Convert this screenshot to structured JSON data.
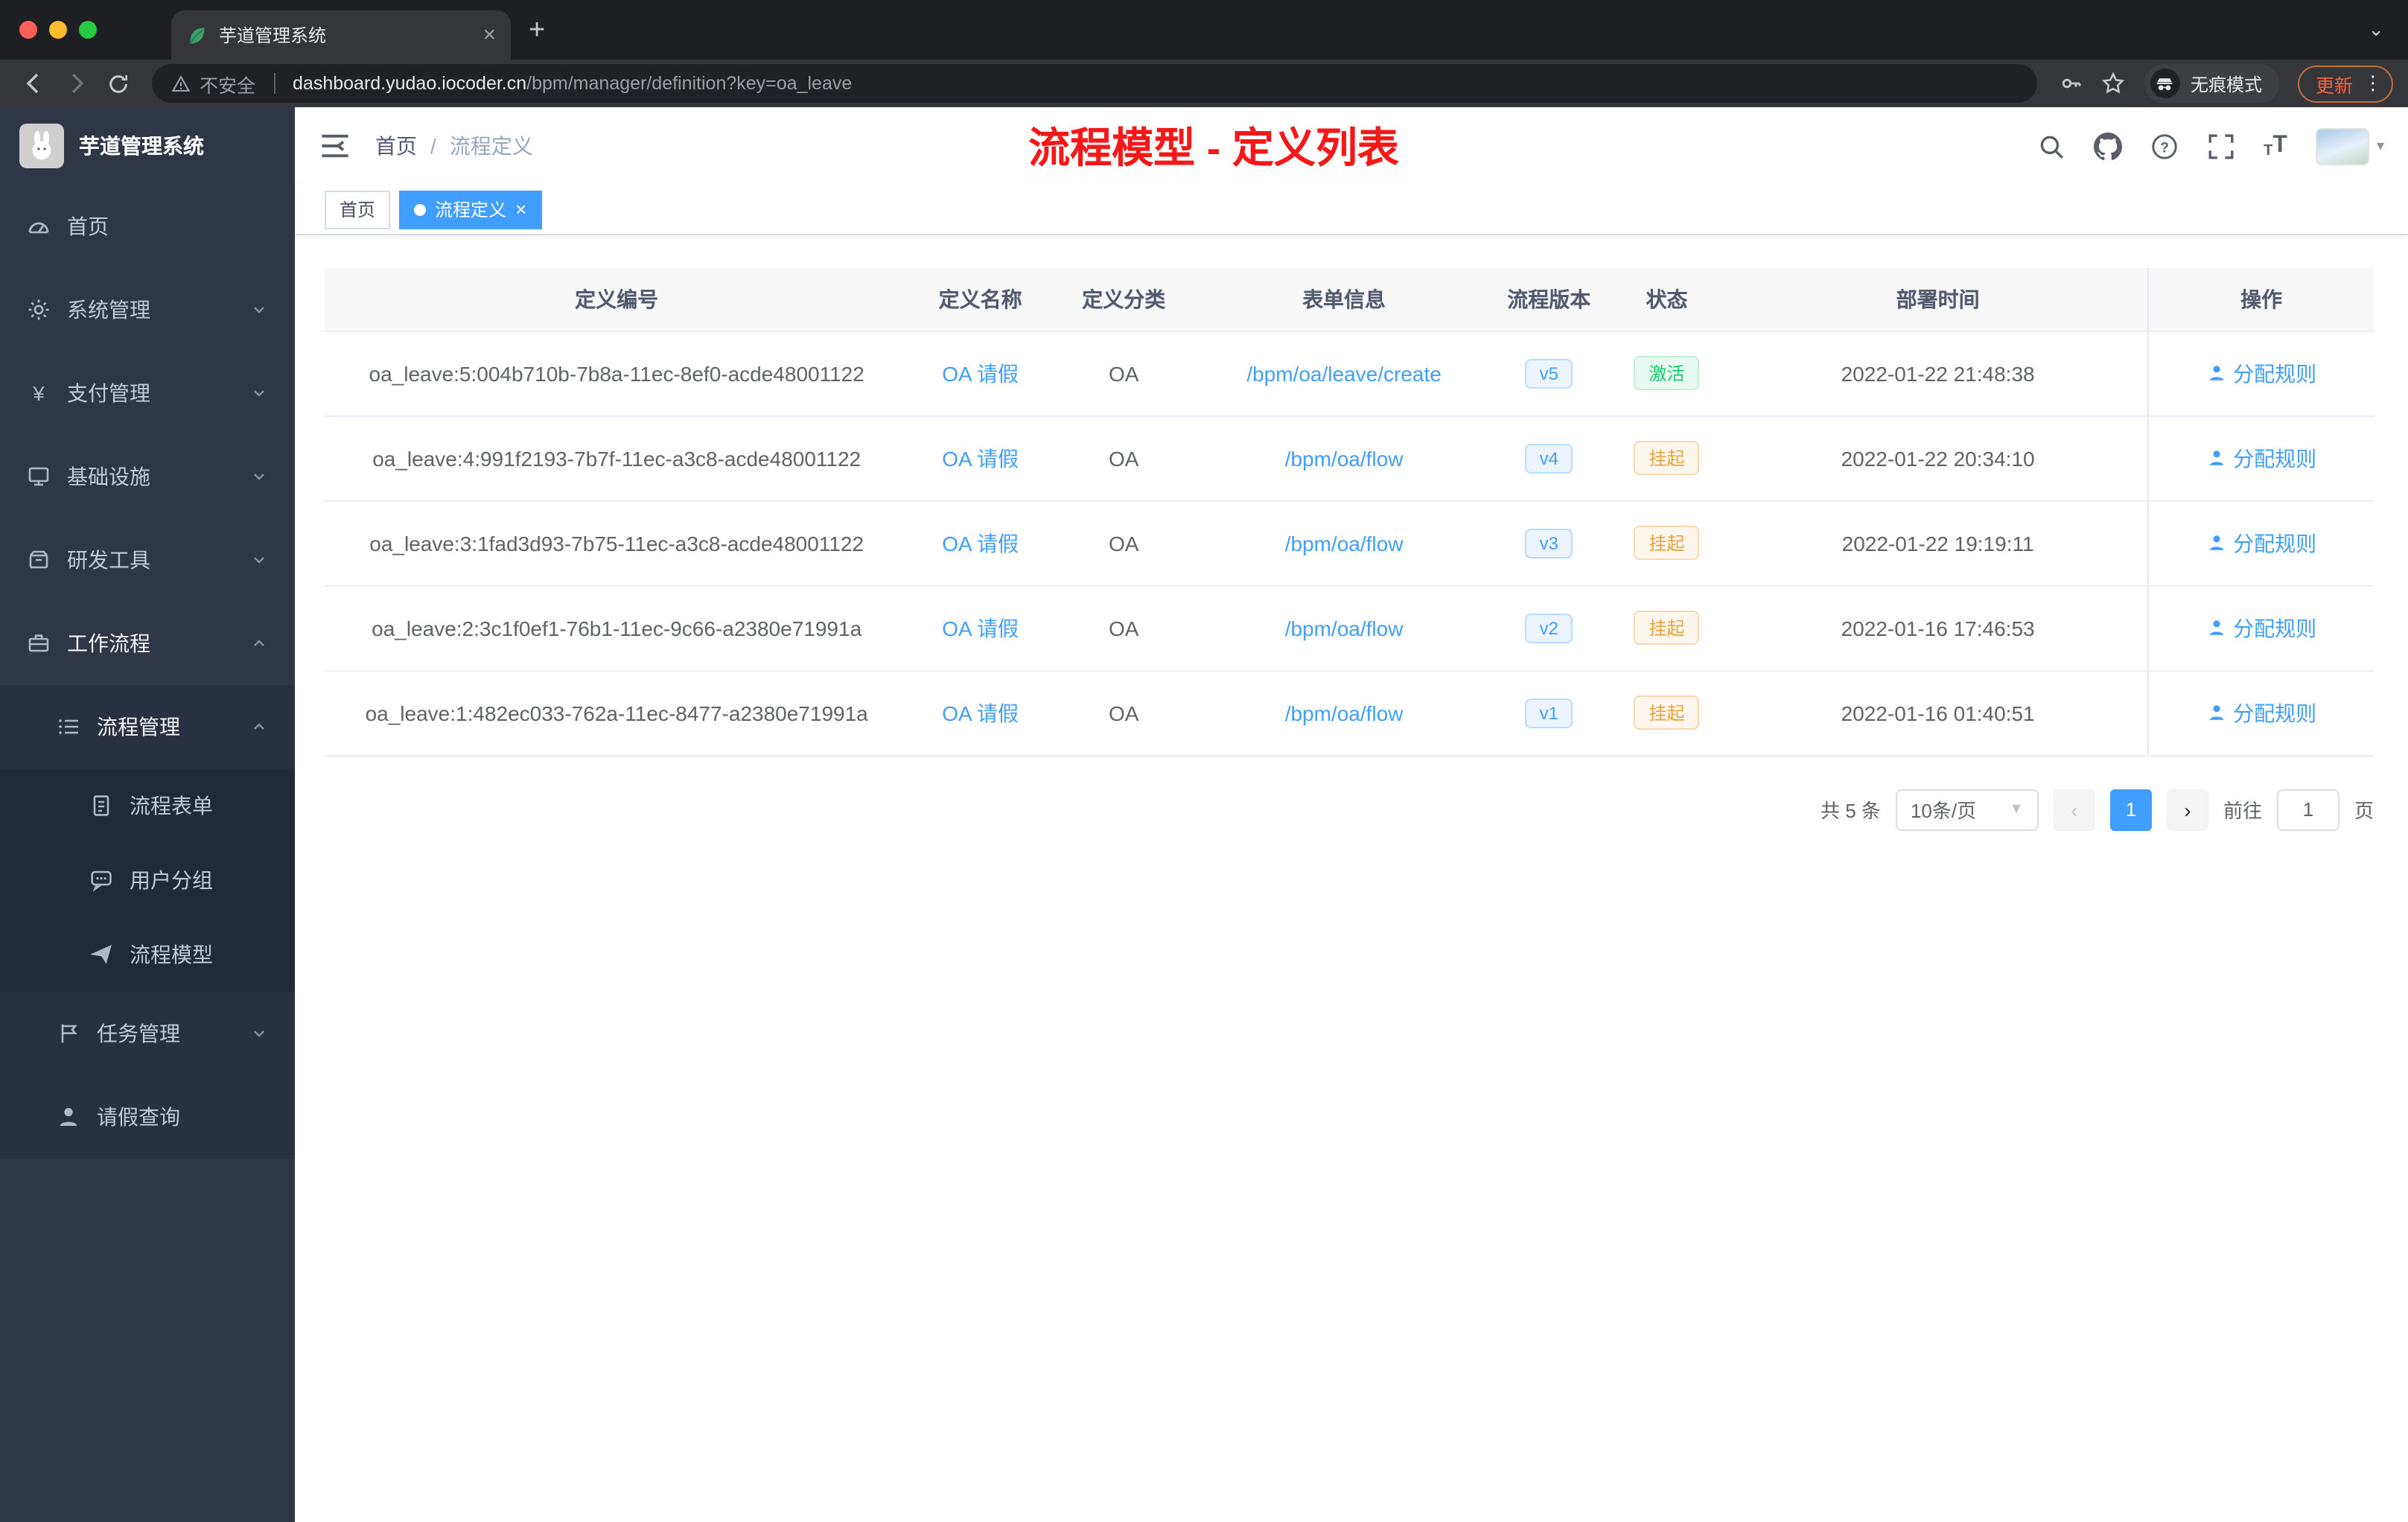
{
  "browser": {
    "tab_title": "芋道管理系统",
    "security_label": "不安全",
    "url_host": "dashboard.yudao.iocoder.cn",
    "url_path": "/bpm/manager/definition?key=oa_leave",
    "incognito_label": "无痕模式",
    "update_label": "更新"
  },
  "sidebar": {
    "logo_title": "芋道管理系统",
    "items": {
      "home": "首页",
      "system": "系统管理",
      "payment": "支付管理",
      "infra": "基础设施",
      "devtools": "研发工具",
      "workflow": "工作流程",
      "process_mgmt": "流程管理",
      "process_form": "流程表单",
      "user_group": "用户分组",
      "process_model": "流程模型",
      "task_mgmt": "任务管理",
      "leave_query": "请假查询"
    }
  },
  "header": {
    "breadcrumb_home": "首页",
    "breadcrumb_sep": "/",
    "breadcrumb_current": "流程定义",
    "annotation": "流程模型 - 定义列表"
  },
  "tags": {
    "home": "首页",
    "active": "流程定义"
  },
  "table": {
    "headers": [
      "定义编号",
      "定义名称",
      "定义分类",
      "表单信息",
      "流程版本",
      "状态",
      "部署时间",
      "操作"
    ],
    "rows": [
      {
        "id": "oa_leave:5:004b710b-7b8a-11ec-8ef0-acde48001122",
        "name": "OA 请假",
        "category": "OA",
        "form": "/bpm/oa/leave/create",
        "version": "v5",
        "status": "激活",
        "status_type": "success",
        "time": "2022-01-22 21:48:38",
        "action": "分配规则"
      },
      {
        "id": "oa_leave:4:991f2193-7b7f-11ec-a3c8-acde48001122",
        "name": "OA 请假",
        "category": "OA",
        "form": "/bpm/oa/flow",
        "version": "v4",
        "status": "挂起",
        "status_type": "warning",
        "time": "2022-01-22 20:34:10",
        "action": "分配规则"
      },
      {
        "id": "oa_leave:3:1fad3d93-7b75-11ec-a3c8-acde48001122",
        "name": "OA 请假",
        "category": "OA",
        "form": "/bpm/oa/flow",
        "version": "v3",
        "status": "挂起",
        "status_type": "warning",
        "time": "2022-01-22 19:19:11",
        "action": "分配规则"
      },
      {
        "id": "oa_leave:2:3c1f0ef1-76b1-11ec-9c66-a2380e71991a",
        "name": "OA 请假",
        "category": "OA",
        "form": "/bpm/oa/flow",
        "version": "v2",
        "status": "挂起",
        "status_type": "warning",
        "time": "2022-01-16 17:46:53",
        "action": "分配规则"
      },
      {
        "id": "oa_leave:1:482ec033-762a-11ec-8477-a2380e71991a",
        "name": "OA 请假",
        "category": "OA",
        "form": "/bpm/oa/flow",
        "version": "v1",
        "status": "挂起",
        "status_type": "warning",
        "time": "2022-01-16 01:40:51",
        "action": "分配规则"
      }
    ]
  },
  "pagination": {
    "total": "共 5 条",
    "page_size": "10条/页",
    "current_page": "1",
    "goto_label": "前往",
    "goto_value": "1",
    "page_unit": "页"
  }
}
